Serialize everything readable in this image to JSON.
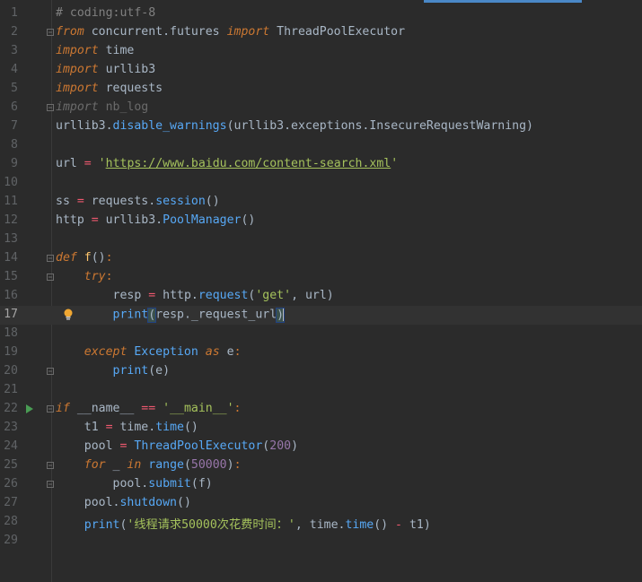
{
  "editor": {
    "current_line": 17,
    "line_numbers": [
      "1",
      "2",
      "3",
      "4",
      "5",
      "6",
      "7",
      "8",
      "9",
      "10",
      "11",
      "12",
      "13",
      "14",
      "15",
      "16",
      "17",
      "18",
      "19",
      "20",
      "21",
      "22",
      "23",
      "24",
      "25",
      "26",
      "27",
      "28",
      "29"
    ],
    "lines": {
      "l1": {
        "comment": "# coding:utf-8"
      },
      "l2": {
        "kw_from": "from",
        "module": " concurrent.futures ",
        "kw_import": "import",
        "name": " ThreadPoolExecutor"
      },
      "l3": {
        "kw_import": "import",
        "name": " time"
      },
      "l4": {
        "kw_import": "import",
        "name": " urllib3"
      },
      "l5": {
        "kw_import": "import",
        "name": " requests"
      },
      "l6": {
        "kw_import": "import",
        "name": " nb_log"
      },
      "l7": {
        "obj": "urllib3.",
        "fn": "disable_warnings",
        "args": "(urllib3.exceptions.InsecureRequestWarning)"
      },
      "l9": {
        "var": "url ",
        "eq": "=",
        "sp": " ",
        "q1": "'",
        "url": "https://www.baidu.com/content-search.xml",
        "q2": "'"
      },
      "l11": {
        "var": "ss ",
        "eq": "=",
        "obj": " requests.",
        "fn": "session",
        "args": "()"
      },
      "l12": {
        "var": "http ",
        "eq": "=",
        "obj": " urllib3.",
        "fn": "PoolManager",
        "args": "()"
      },
      "l14": {
        "kw_def": "def",
        "sp": " ",
        "fn": "f",
        "args": "()",
        "colon": ":"
      },
      "l15": {
        "indent": "    ",
        "kw_try": "try",
        "colon": ":"
      },
      "l16": {
        "indent": "        ",
        "var": "resp ",
        "eq": "=",
        "obj": " http.",
        "fn": "request",
        "p1": "(",
        "str": "'get'",
        "p2": ", url)"
      },
      "l17": {
        "indent": "        ",
        "fn": "print",
        "p1": "(",
        "args": "resp._request_url",
        "p2": ")"
      },
      "l19": {
        "indent": "    ",
        "kw_except": "except",
        "sp": " ",
        "cls": "Exception",
        "sp2": " ",
        "kw_as": "as",
        "var": " e",
        "colon": ":"
      },
      "l20": {
        "indent": "        ",
        "fn": "print",
        "args": "(e)"
      },
      "l22": {
        "kw_if": "if",
        "name": " __name__ ",
        "eq": "==",
        "sp": " ",
        "str": "'__main__'",
        "colon": ":"
      },
      "l23": {
        "indent": "    ",
        "var": "t1 ",
        "eq": "=",
        "obj": " time.",
        "fn": "time",
        "args": "()"
      },
      "l24": {
        "indent": "    ",
        "var": "pool ",
        "eq": "=",
        "sp": " ",
        "cls": "ThreadPoolExecutor",
        "p1": "(",
        "num": "200",
        "p2": ")"
      },
      "l25": {
        "indent": "    ",
        "kw_for": "for",
        "var": " _ ",
        "kw_in": "in",
        "sp": " ",
        "fn": "range",
        "p1": "(",
        "num": "50000",
        "p2": ")",
        "colon": ":"
      },
      "l26": {
        "indent": "        ",
        "obj": "pool.",
        "fn": "submit",
        "args": "(f)"
      },
      "l27": {
        "indent": "    ",
        "obj": "pool.",
        "fn": "shutdown",
        "args": "()"
      },
      "l28": {
        "indent": "    ",
        "fn": "print",
        "p1": "(",
        "str": "'线程请求50000次花费时间：'",
        "mid": ", time.",
        "fn2": "time",
        "args": "() ",
        "minus": "-",
        "end": " t1)"
      }
    }
  },
  "colors": {
    "background": "#2b2b2b",
    "current_line": "#323232",
    "keyword": "#cc7832",
    "string": "#a5c25c",
    "function": "#57a8f5",
    "number": "#9876aa",
    "operator": "#ef596f",
    "comment": "#808080",
    "run_marker": "#499c54",
    "bulb": "#f0a732"
  },
  "icons": {
    "run_gutter": "run-arrow-icon",
    "intention": "lightbulb-icon",
    "fold": "fold-marker-icon"
  }
}
